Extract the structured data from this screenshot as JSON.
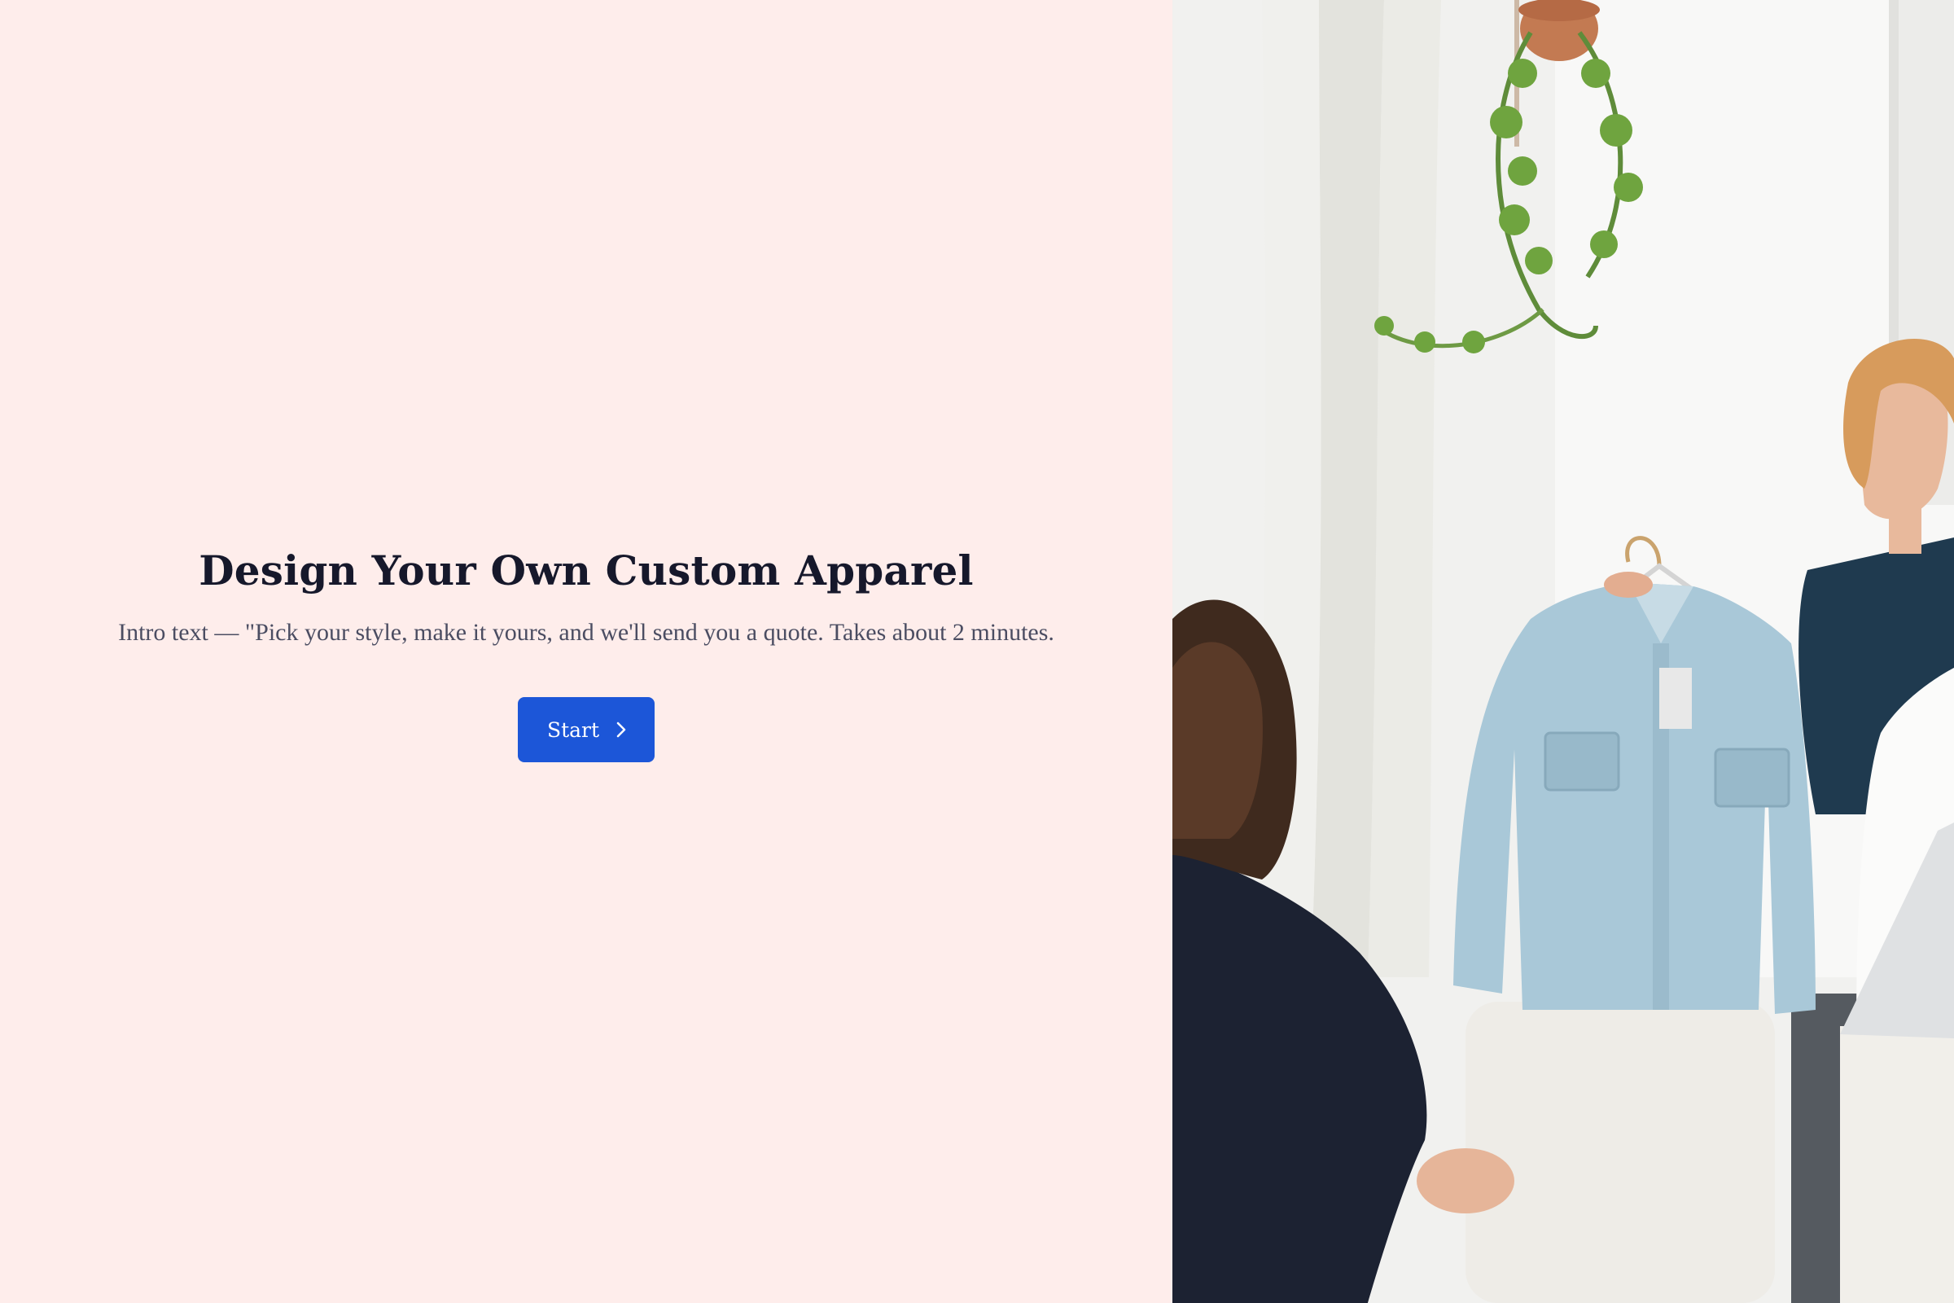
{
  "hero": {
    "title": "Design Your Own Custom Apparel",
    "intro_text": "Intro text — \"Pick your style, make it yours, and we'll send you a quote. Takes about 2 minutes.",
    "start_label": "Start",
    "start_icon": "chevron-right-icon"
  },
  "photo": {
    "description_icon": "boutique-photo"
  },
  "colors": {
    "left_background": "#feedeb",
    "title": "#16182b",
    "body_text": "#4b4d62",
    "button": "#1c56d8",
    "button_text": "#ffffff"
  }
}
